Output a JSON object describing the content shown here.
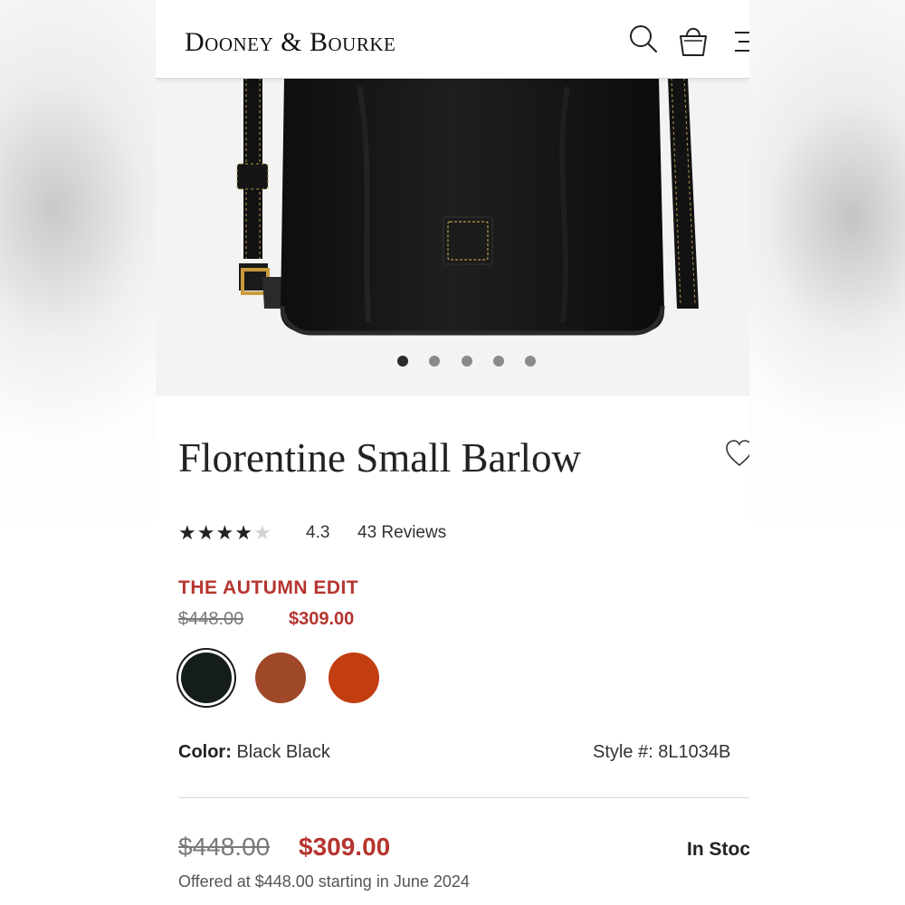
{
  "header": {
    "brand": "Dooney & Bourke",
    "icons": [
      "search-icon",
      "shopping-bag-icon",
      "menu-icon"
    ]
  },
  "gallery": {
    "image": "black leather bucket bag with shoulder strap",
    "dot_count": 5,
    "active_index": 0
  },
  "product": {
    "title": "Florentine Small Barlow",
    "rating_value": 4.3,
    "rating_text": "4.3",
    "stars_filled": 4,
    "stars_total": 5,
    "reviews": "43 Reviews",
    "promo_label": "THE AUTUMN EDIT",
    "original_price": "$448.00",
    "sale_price": "$309.00",
    "color_label": "Color:",
    "color_value": "Black Black",
    "style_label": "Style #:",
    "style_value": "8L1034B",
    "stock_status": "In Stoc",
    "offered_note": "Offered at $448.00 starting in June 2024"
  },
  "swatches": [
    {
      "name": "Black",
      "color": "#141c1c",
      "selected": true
    },
    {
      "name": "Brown",
      "color": "#a0482a",
      "selected": false
    },
    {
      "name": "Orange",
      "color": "#c23d10",
      "selected": false
    }
  ],
  "colors": {
    "accent_red": "#b5352f",
    "text_dark": "#222222"
  }
}
